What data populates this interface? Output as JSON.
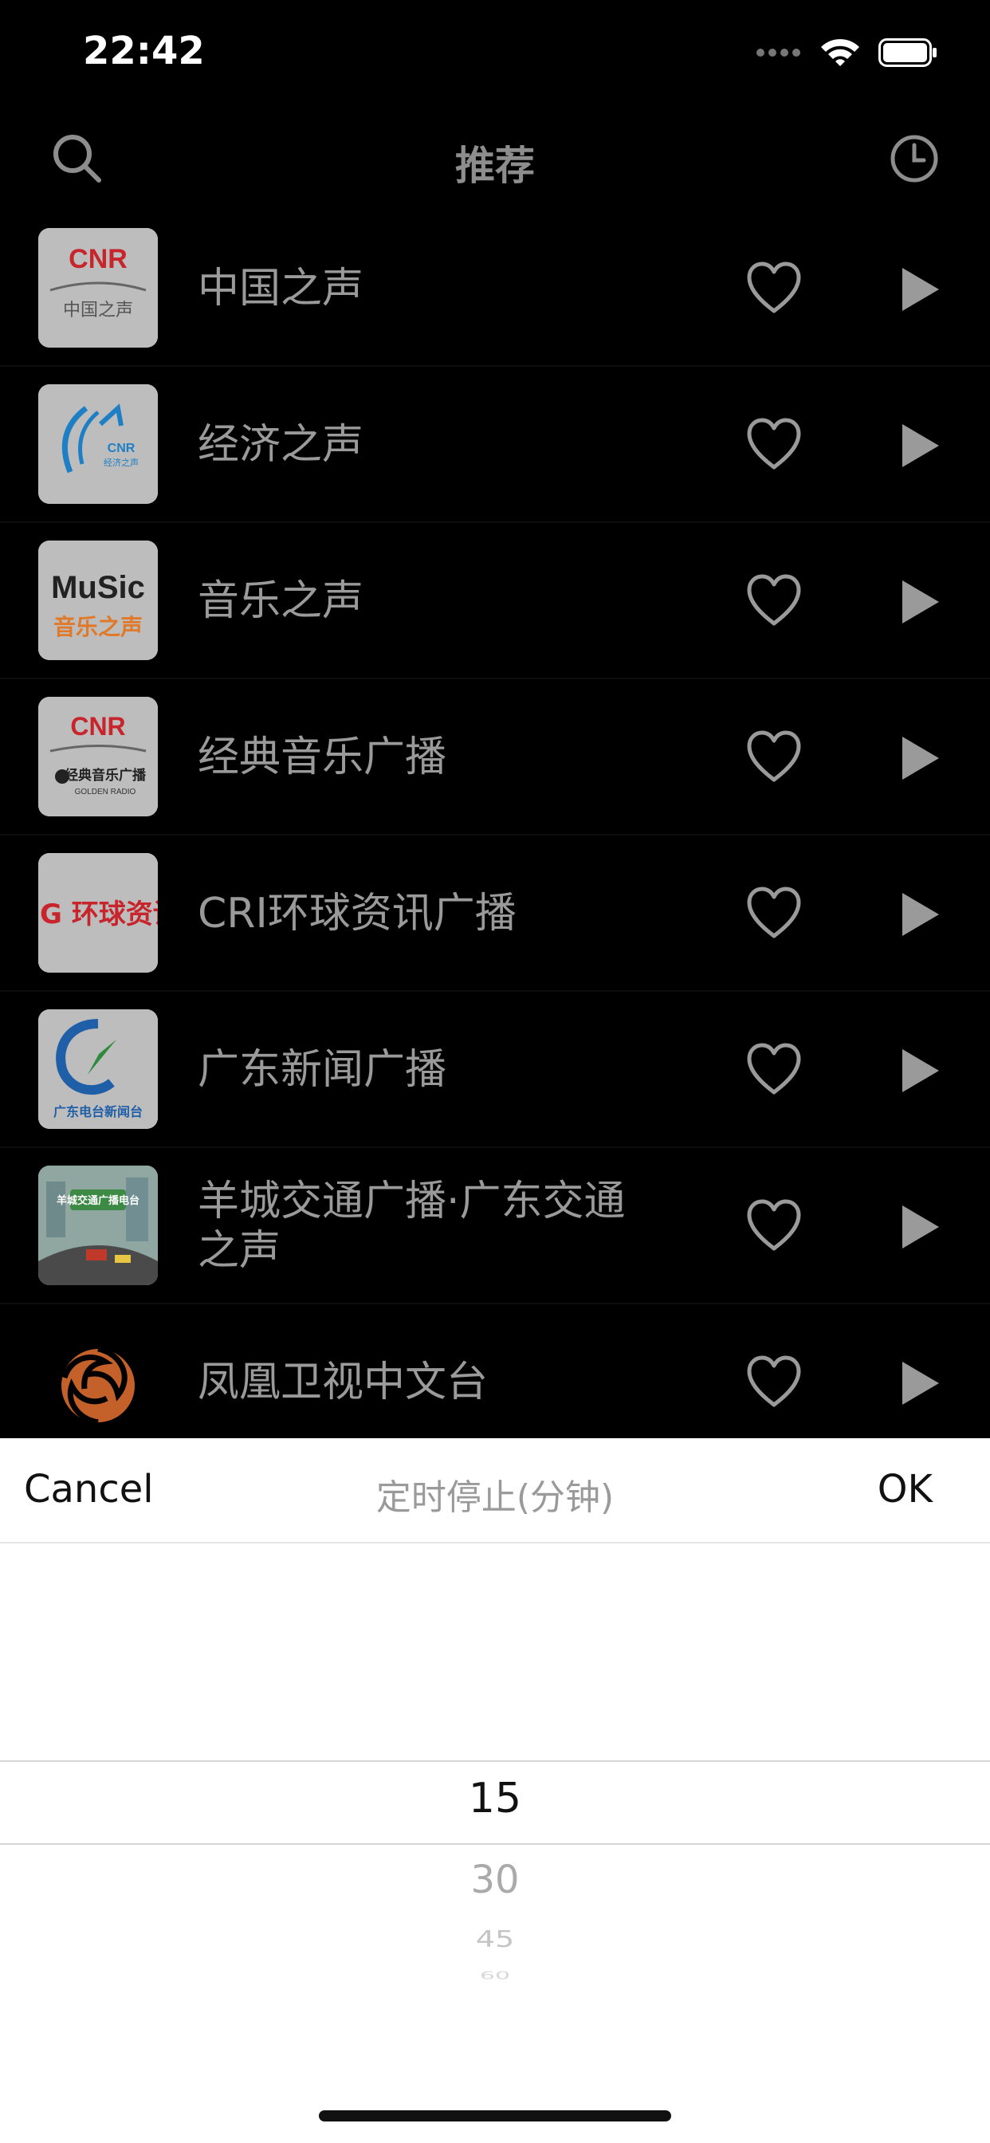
{
  "status_bar": {
    "time": "22:42"
  },
  "nav": {
    "title": "推荐"
  },
  "stations": [
    {
      "name": "中国之声",
      "logo": "CNR 中国之声",
      "logo_lines": [
        "CNR",
        "中国之声"
      ]
    },
    {
      "name": "经济之声",
      "logo": "CNR 经济之声",
      "logo_lines": [
        "CNR",
        "经济之声"
      ]
    },
    {
      "name": "音乐之声",
      "logo": "Music 音乐之声",
      "logo_lines": [
        "MuSic",
        "音乐之声"
      ]
    },
    {
      "name": "经典音乐广播",
      "logo": "CNR 经典音乐广播 GOLDEN RADIO",
      "logo_lines": [
        "CNR",
        "经典音乐广播",
        "GOLDEN RADIO"
      ]
    },
    {
      "name": "CRI环球资讯广播",
      "logo": "环球资讯",
      "logo_lines": [
        "G 环球资讯"
      ]
    },
    {
      "name": "广东新闻广播",
      "logo": "广东电台新闻台",
      "logo_lines": [
        "广东电台新闻台"
      ]
    },
    {
      "name": "羊城交通广播·广东交通之声",
      "logo": "羊城交通广播电台",
      "logo_lines": [
        "羊城交通广播电台"
      ]
    },
    {
      "name": "凤凰卫视中文台",
      "logo": "phoenix-logo",
      "logo_lines": []
    }
  ],
  "timer_sheet": {
    "cancel_label": "Cancel",
    "title": "定时停止(分钟)",
    "ok_label": "OK",
    "options": [
      "15",
      "30",
      "45",
      "60"
    ],
    "selected": "15"
  },
  "colors": {
    "background": "#000000",
    "row_text": "#9a9a9a",
    "sheet_background": "#ffffff",
    "logo_red": "#c8242b",
    "logo_blue": "#1f7fc4"
  },
  "icons": {
    "search": "search-icon",
    "history": "clock-icon",
    "favorite": "heart-outline-icon",
    "play": "play-icon"
  }
}
